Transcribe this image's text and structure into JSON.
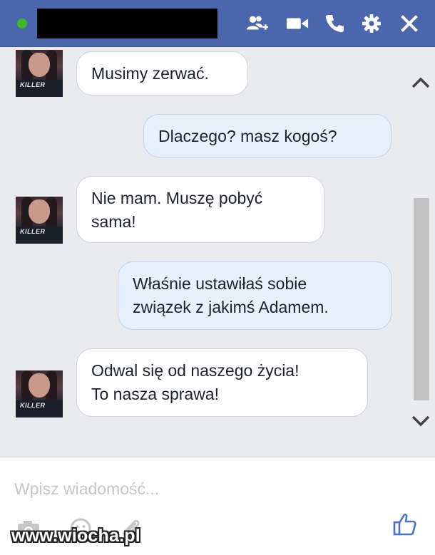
{
  "header": {
    "status": "online",
    "contact_name": "",
    "icons": [
      "add-friend-icon",
      "video-call-icon",
      "phone-icon",
      "gear-icon",
      "close-icon"
    ],
    "color": "#4a67ad"
  },
  "messages": [
    {
      "sender": "them",
      "text": "Musimy zerwać."
    },
    {
      "sender": "me",
      "text": "Dlaczego? masz kogoś?"
    },
    {
      "sender": "them",
      "line1": "Nie mam. Muszę pobyć",
      "line2": "sama!"
    },
    {
      "sender": "me",
      "line1": "Właśnie ustawiłaś sobie",
      "line2": "związek z jakimś Adamem."
    },
    {
      "sender": "them",
      "line1": "Odwal się od naszego życia!",
      "line2": "To nasza sprawa!"
    }
  ],
  "avatar": {
    "shirt_text": "KILLER"
  },
  "composer": {
    "placeholder": "Wpisz wiadomość...",
    "value": "",
    "tools": [
      "camera-icon",
      "emoji-icon",
      "attachment-icon"
    ],
    "like_icon": "thumbs-up-icon"
  },
  "watermark": "www.wiocha.pl"
}
